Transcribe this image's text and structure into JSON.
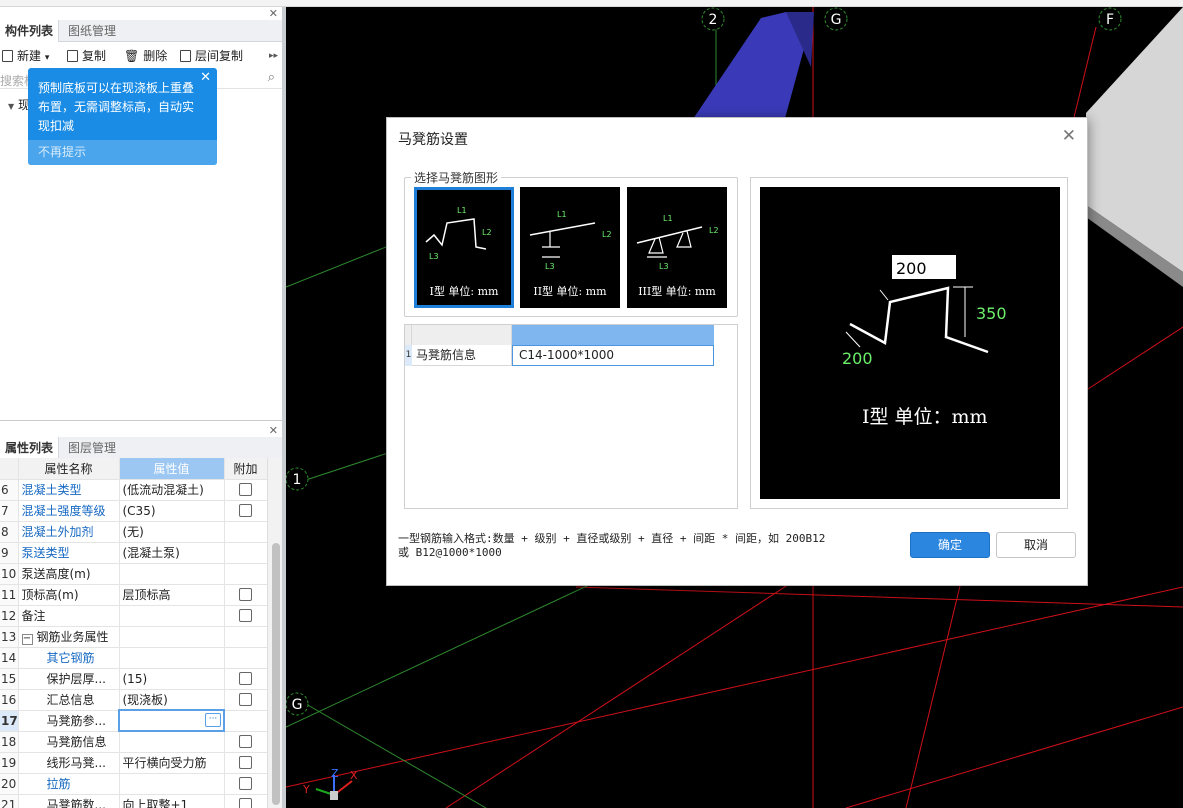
{
  "component_panel": {
    "tabs": [
      "构件列表",
      "图纸管理"
    ],
    "toolbar": {
      "new": "新建",
      "copy": "复制",
      "delete": "删除",
      "floor_copy": "层间复制",
      "more": "▸▸"
    },
    "search_placeholder": "搜索构",
    "tree_item": "现"
  },
  "tooltip": {
    "message": "预制底板可以在现浇板上重叠布置，无需调整标高，自动实现扣减",
    "dismiss": "不再提示"
  },
  "property_panel": {
    "tabs": [
      "属性列表",
      "图层管理"
    ],
    "headers": {
      "name": "属性名称",
      "value": "属性值",
      "extra": "附加"
    },
    "rows": [
      {
        "n": "6",
        "name": "混凝土类型",
        "value": "(低流动混凝土)"
      },
      {
        "n": "7",
        "name": "混凝土强度等级",
        "value": "(C35)"
      },
      {
        "n": "8",
        "name": "混凝土外加剂",
        "value": "(无)"
      },
      {
        "n": "9",
        "name": "泵送类型",
        "value": "(混凝土泵)"
      },
      {
        "n": "10",
        "name": "泵送高度(m)",
        "value": ""
      },
      {
        "n": "11",
        "name": "顶标高(m)",
        "value": "层顶标高"
      },
      {
        "n": "12",
        "name": "备注",
        "value": ""
      },
      {
        "n": "13",
        "name": "钢筋业务属性",
        "value": ""
      },
      {
        "n": "14",
        "name": "其它钢筋",
        "value": ""
      },
      {
        "n": "15",
        "name": "保护层厚...",
        "value": "(15)"
      },
      {
        "n": "16",
        "name": "汇总信息",
        "value": "(现浇板)"
      },
      {
        "n": "17",
        "name": "马凳筋参...",
        "value": ""
      },
      {
        "n": "18",
        "name": "马凳筋信息",
        "value": ""
      },
      {
        "n": "19",
        "name": "线形马凳...",
        "value": "平行横向受力筋"
      },
      {
        "n": "20",
        "name": "拉筋",
        "value": ""
      },
      {
        "n": "21",
        "name": "马凳筋数...",
        "value": "向上取整+1"
      }
    ],
    "ellipsis": "···"
  },
  "viewport": {
    "axis_labels": {
      "a2": "2",
      "aG_top": "G",
      "aF": "F",
      "a1": "1",
      "aG_left": "G"
    },
    "axes": {
      "y": "Y",
      "z": "Z",
      "x": "X"
    }
  },
  "dialog": {
    "title": "马凳筋设置",
    "group_label": "选择马凳筋图形",
    "shapes": [
      {
        "caption": "I型 单位: mm",
        "labels": [
          "L1",
          "L2",
          "L3"
        ]
      },
      {
        "caption": "II型 单位: mm",
        "labels": [
          "L1",
          "L2",
          "L3"
        ]
      },
      {
        "caption": "III型 单位: mm",
        "labels": [
          "L1",
          "L2",
          "L3"
        ]
      }
    ],
    "table": {
      "row_num": "1",
      "label": "马凳筋信息",
      "value": "C14-1000*1000"
    },
    "preview": {
      "l1": "200",
      "l2": "350",
      "l3": "200",
      "caption": "I型 单位：mm"
    },
    "hint_line1": "一型钢筋输入格式:数量 + 级别 + 直径或级别 + 直径 + 间距 * 间距，如 200B12",
    "hint_line2": "或 B12@1000*1000",
    "ok": "确定",
    "cancel": "取消"
  },
  "colors": {
    "accent": "#2b86e0",
    "tooltip": "#1a8ce6",
    "prop_link": "#1769c2",
    "grid_red": "#d0101a",
    "grid_green": "#2f8a2f"
  }
}
